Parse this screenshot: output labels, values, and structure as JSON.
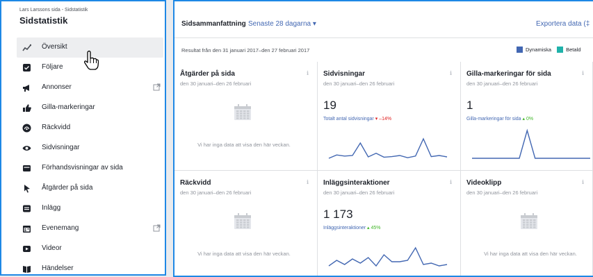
{
  "sidebar": {
    "page_name": "Lars Larssons sida - Sidstatistik",
    "title": "Sidstatistik",
    "items": [
      {
        "label": "Översikt",
        "icon": "overview-icon",
        "active": true
      },
      {
        "label": "Följare",
        "icon": "check-box-icon"
      },
      {
        "label": "Annonser",
        "icon": "megaphone-icon",
        "external": true
      },
      {
        "label": "Gilla-markeringar",
        "icon": "thumbs-up-icon"
      },
      {
        "label": "Räckvidd",
        "icon": "reach-icon"
      },
      {
        "label": "Sidvisningar",
        "icon": "eye-icon"
      },
      {
        "label": "Förhandsvisningar av sida",
        "icon": "card-icon"
      },
      {
        "label": "Åtgärder på sida",
        "icon": "cursor-icon"
      },
      {
        "label": "Inlägg",
        "icon": "posts-icon"
      },
      {
        "label": "Evenemang",
        "icon": "calendar-icon",
        "external": true
      },
      {
        "label": "Videor",
        "icon": "video-icon"
      },
      {
        "label": "Händelser",
        "icon": "book-icon"
      }
    ]
  },
  "header": {
    "summary_title": "Sidsammanfattning",
    "period": "Senaste 28 dagarna ▾",
    "export": "Exportera data (‡"
  },
  "subheader": {
    "results": "Resultat från den 31 januari 2017–den 27 februari 2017",
    "legend": [
      {
        "label": "Dynamiska",
        "color": "#4267b2"
      },
      {
        "label": "Betald",
        "color": "#20b2aa"
      }
    ]
  },
  "cards": [
    {
      "title": "Åtgärder på sida",
      "date": "den 30 januari–den 26 februari",
      "nodata": "Vi har inga data att visa den här veckan."
    },
    {
      "title": "Sidvisningar",
      "date": "den 30 januari–den 26 februari",
      "value": "19",
      "sub": "Totalt antal sidvisningar",
      "change": "▾ –14%",
      "trend": "down",
      "spark": [
        0,
        0.12,
        0.08,
        0.1,
        0.55,
        0.05,
        0.18,
        0.04,
        0.06,
        0.1,
        0.02,
        0.08,
        0.7,
        0.06,
        0.1,
        0.05
      ]
    },
    {
      "title": "Gilla-markeringar för sida",
      "date": "den 30 januari–den 26 februari",
      "value": "1",
      "sub": "Gilla-markeringar för sida",
      "change": "▴ 0%",
      "trend": "up",
      "spark": [
        0,
        0,
        0,
        0,
        0,
        0,
        0,
        1,
        0,
        0,
        0,
        0,
        0,
        0,
        0,
        0
      ]
    },
    {
      "title": "Räckvidd",
      "date": "den 30 januari–den 26 februari",
      "nodata": "Vi har inga data att visa den här veckan."
    },
    {
      "title": "Inläggsinteraktioner",
      "date": "den 30 januari–den 26 februari",
      "value": "1 173",
      "sub": "Inläggsinteraktioner",
      "change": "▴ 45%",
      "trend": "up",
      "spark": [
        0.05,
        0.25,
        0.1,
        0.3,
        0.15,
        0.35,
        0.05,
        0.45,
        0.2,
        0.2,
        0.25,
        0.7,
        0.1,
        0.15,
        0.05,
        0.1
      ]
    },
    {
      "title": "Videoklipp",
      "date": "den 30 januari–den 26 februari",
      "nodata": "Vi har inga data att visa den här veckan."
    }
  ]
}
